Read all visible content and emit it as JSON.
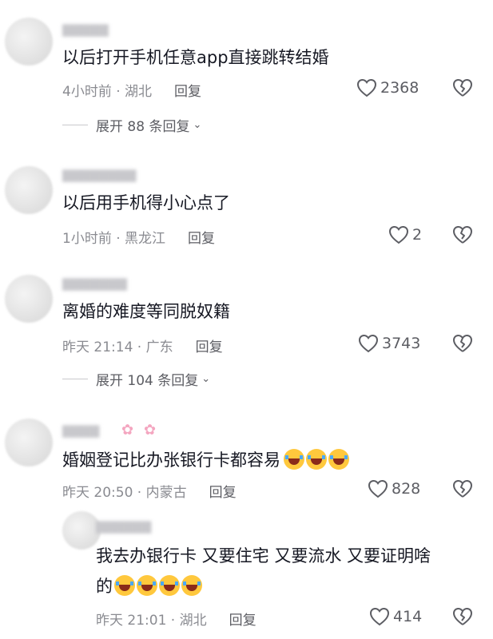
{
  "comments": [
    {
      "text": "以后打开手机任意app直接跳转结婚",
      "time_location": "4小时前 · 湖北",
      "reply": "回复",
      "likes": "2368",
      "expand": "展开 88 条回复"
    },
    {
      "text": "以后用手机得小心点了",
      "time_location": "1小时前 · 黑龙江",
      "reply": "回复",
      "likes": "2"
    },
    {
      "text": "离婚的难度等同脱奴籍",
      "time_location": "昨天 21:14 · 广东",
      "reply": "回复",
      "likes": "3743",
      "expand": "展开 104 条回复"
    },
    {
      "text": "婚姻登记比办张银行卡都容易",
      "time_location": "昨天 20:50 · 内蒙古",
      "reply": "回复",
      "likes": "828",
      "emoji_count": 3
    },
    {
      "text_line1": "我去办银行卡  又要住宅 又要流水 又要证明啥",
      "text_line2": "的",
      "time_location": "昨天 21:01 · 湖北",
      "reply": "回复",
      "likes": "414",
      "emoji_count": 4
    }
  ]
}
